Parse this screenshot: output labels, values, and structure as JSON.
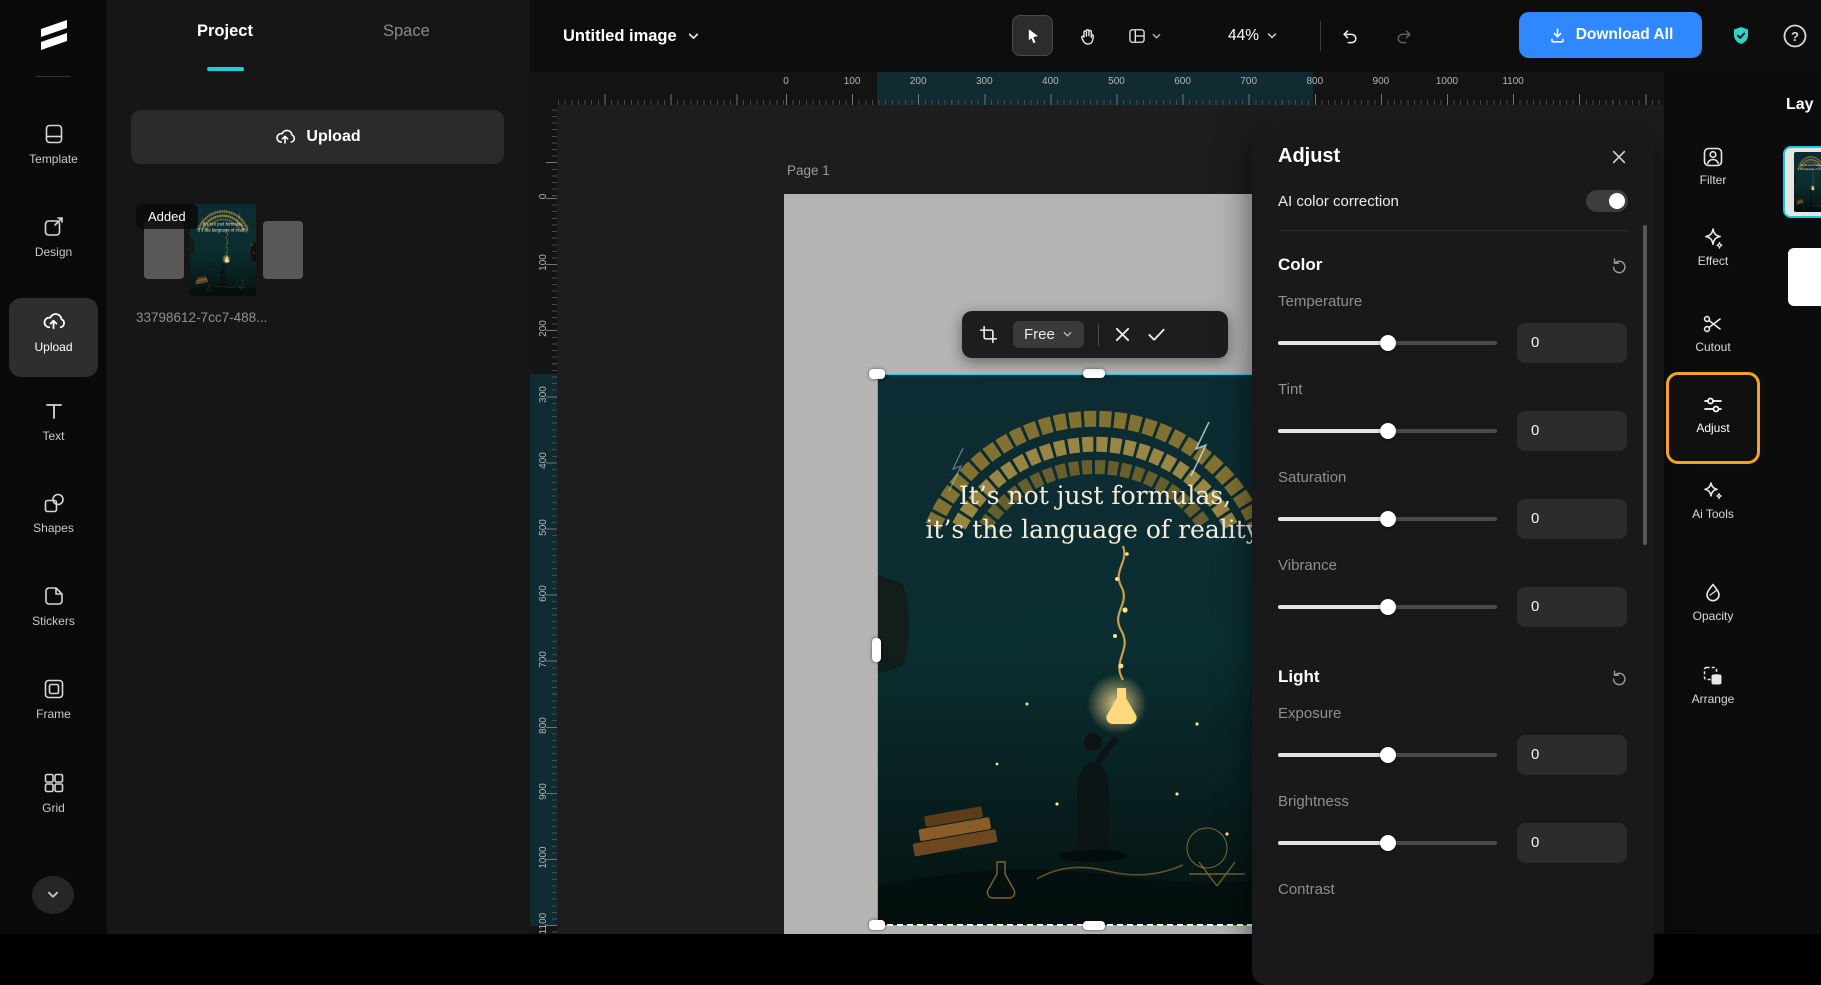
{
  "app": {
    "logo": "capcut-logo"
  },
  "left_nav": {
    "items": [
      {
        "label": "Template",
        "active": false
      },
      {
        "label": "Design",
        "active": false
      },
      {
        "label": "Upload",
        "active": true
      },
      {
        "label": "Text",
        "active": false
      },
      {
        "label": "Shapes",
        "active": false
      },
      {
        "label": "Stickers",
        "active": false
      },
      {
        "label": "Frame",
        "active": false
      },
      {
        "label": "Grid",
        "active": false
      }
    ]
  },
  "asset_panel": {
    "tab_project": "Project",
    "tab_space": "Space",
    "upload_button_label": "Upload",
    "asset_badge": "Added",
    "asset_filename": "33798612-7cc7-488..."
  },
  "topbar": {
    "document_title": "Untitled image",
    "zoom_level": "44%",
    "download_button_label": "Download All"
  },
  "canvas": {
    "page_label": "Page 1",
    "crop_ratio_label": "Free",
    "poster_quote_line1": "It’s not just formulas,",
    "poster_quote_line2": "it’s the language of reality."
  },
  "adjust_panel": {
    "title": "Adjust",
    "ai_color_correction_label": "AI color correction",
    "color": {
      "title": "Color",
      "sliders": [
        {
          "label": "Temperature",
          "value": "0"
        },
        {
          "label": "Tint",
          "value": "0"
        },
        {
          "label": "Saturation",
          "value": "0"
        },
        {
          "label": "Vibrance",
          "value": "0"
        }
      ]
    },
    "light": {
      "title": "Light",
      "sliders": [
        {
          "label": "Exposure",
          "value": "0"
        },
        {
          "label": "Brightness",
          "value": "0"
        }
      ],
      "partial_label": "Contrast"
    }
  },
  "right_tools": {
    "items": [
      {
        "label": "Filter",
        "active": false
      },
      {
        "label": "Effect",
        "active": false
      },
      {
        "label": "Cutout",
        "active": false
      },
      {
        "label": "Adjust",
        "active": true
      },
      {
        "label": "Ai Tools",
        "active": false
      },
      {
        "label": "Opacity",
        "active": false
      },
      {
        "label": "Arrange",
        "active": false
      }
    ]
  },
  "layers_panel": {
    "title": "Lay"
  },
  "rulers": {
    "horizontal_labels": [
      "0",
      "100",
      "200",
      "300",
      "400",
      "500",
      "600",
      "700",
      "800",
      "900",
      "1000",
      "1100"
    ],
    "vertical_labels": [
      "0",
      "100",
      "200",
      "300",
      "400",
      "500",
      "600",
      "700",
      "800",
      "900",
      "1000",
      "1100"
    ]
  },
  "colors": {
    "accent_teal": "#1ad1d6",
    "selection_cyan": "#14cfe4",
    "highlight_orange": "#f7a227",
    "download_blue": "#2f88ff"
  }
}
